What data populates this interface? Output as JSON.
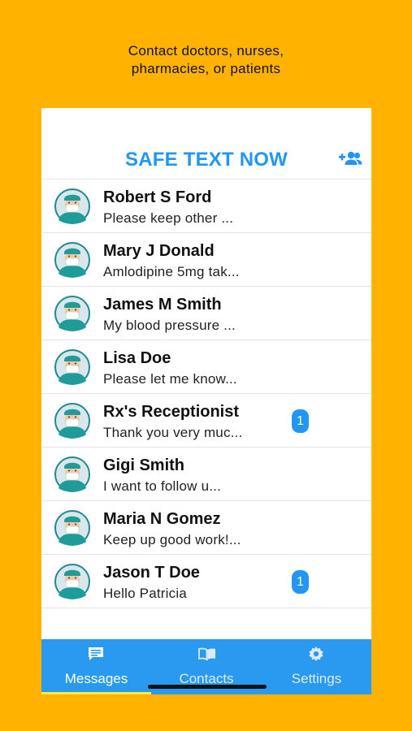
{
  "tagline": {
    "line1": "Contact doctors, nurses,",
    "line2": "pharmacies, or patients"
  },
  "header": {
    "title": "SAFE TEXT NOW",
    "add_icon": "add-contact-icon"
  },
  "conversations": [
    {
      "name": "Robert S Ford",
      "preview": "Please keep other ...",
      "unread": null
    },
    {
      "name": "Mary J Donald",
      "preview": "Amlodipine 5mg tak...",
      "unread": null
    },
    {
      "name": "James M Smith",
      "preview": "My blood pressure ...",
      "unread": null
    },
    {
      "name": "Lisa Doe",
      "preview": "Please let me know...",
      "unread": null
    },
    {
      "name": "Rx's Receptionist",
      "preview": "Thank you very muc...",
      "unread": "1"
    },
    {
      "name": "Gigi Smith",
      "preview": "I want to follow u...",
      "unread": null
    },
    {
      "name": "Maria N Gomez",
      "preview": "Keep up good work!...",
      "unread": null
    },
    {
      "name": "Jason T Doe",
      "preview": "Hello Patricia",
      "unread": "1"
    }
  ],
  "tabs": [
    {
      "label": "Messages",
      "icon": "message-icon",
      "active": true
    },
    {
      "label": "Contacts",
      "icon": "book-icon",
      "active": false
    },
    {
      "label": "Settings",
      "icon": "gear-icon",
      "active": false
    }
  ],
  "colors": {
    "background": "#FFB300",
    "accent": "#2196F3",
    "tabbar": "#2A9AF0",
    "active_indicator": "#FFEB3B"
  }
}
